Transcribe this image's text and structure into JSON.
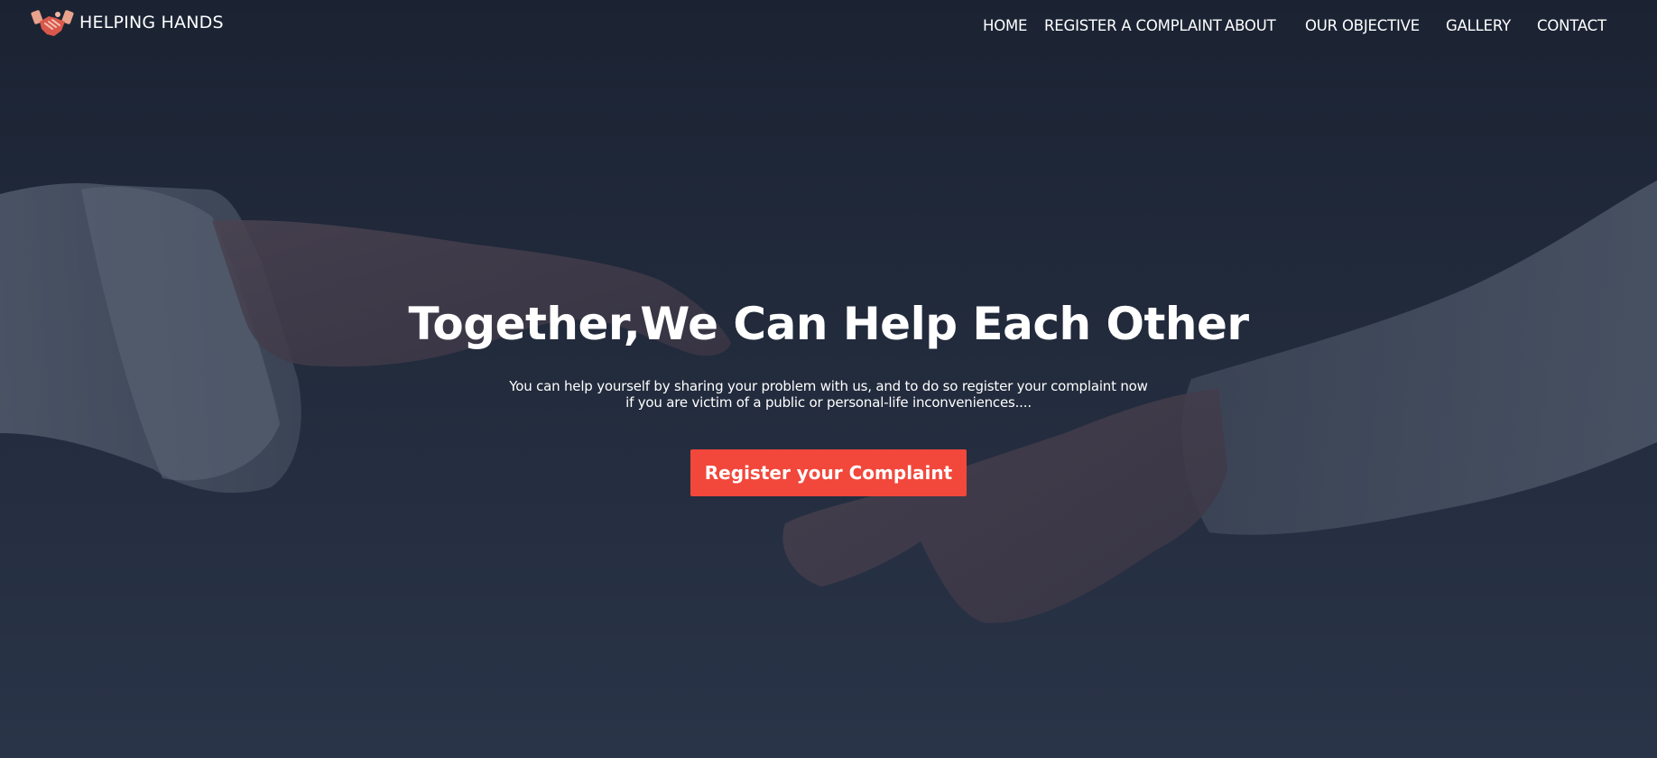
{
  "brand": {
    "name": "HELPING HANDS",
    "icon": "handshake-icon",
    "accent": "#f2473b"
  },
  "nav": {
    "items": [
      {
        "label": "HOME"
      },
      {
        "label": "REGISTER A COMPLAINT"
      },
      {
        "label": "ABOUT"
      },
      {
        "label": "OUR OBJECTIVE"
      },
      {
        "label": "GALLERY"
      },
      {
        "label": "CONTACT"
      }
    ]
  },
  "hero": {
    "headline": "Together,We Can Help Each Other",
    "subtext_line1": "You can help yourself by sharing your problem with us, and to do so register your complaint now",
    "subtext_line2": "if you are victim of a public or personal-life inconveniences....",
    "cta_label": "Register your Complaint",
    "cta_color": "#f2473b",
    "overlay_color": "#1b2333"
  }
}
